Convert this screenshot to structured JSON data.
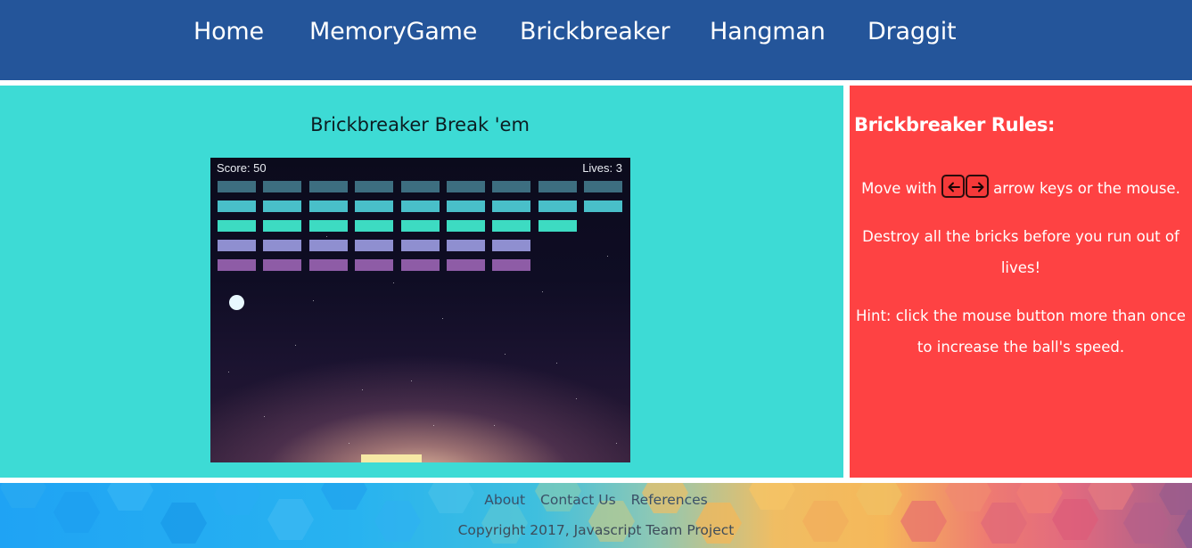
{
  "nav": {
    "items": [
      {
        "label": "Home"
      },
      {
        "label": "MemoryGame"
      },
      {
        "label": "Brickbreaker"
      },
      {
        "label": "Hangman"
      },
      {
        "label": "Draggit"
      }
    ]
  },
  "game": {
    "title": "Brickbreaker Break 'em",
    "score_text": "Score: 50",
    "lives_text": "Lives: 3",
    "score": 50,
    "lives": 3,
    "brick_rows": [
      {
        "color": "#3d6e80",
        "count": 9
      },
      {
        "color": "#49bfc9",
        "count": 9
      },
      {
        "color": "#3ddbc2",
        "count": 8
      },
      {
        "color": "#8f8fd0",
        "count": 7
      },
      {
        "color": "#8e5ca6",
        "count": 7
      }
    ],
    "ball_color": "#e8f8ff",
    "paddle_color": "#f6e9a5"
  },
  "rules": {
    "title": "Brickbreaker Rules:",
    "move_prefix": "Move with",
    "move_suffix": "arrow keys or the mouse.",
    "destroy_line1": "Destroy all the bricks before you run out of",
    "destroy_line2": "lives!",
    "hint_line1": "Hint: click the mouse button more than once",
    "hint_line2": "to increase the ball's speed.",
    "keys": [
      "left-arrow-key-icon",
      "right-arrow-key-icon"
    ]
  },
  "footer": {
    "links": [
      {
        "label": "About"
      },
      {
        "label": "Contact Us"
      },
      {
        "label": "References"
      }
    ],
    "copyright": "Copyright 2017, Javascript Team Project"
  },
  "colors": {
    "nav_bg": "#24559a",
    "game_bg": "#3ddbd5",
    "rules_bg": "#fe4243"
  }
}
